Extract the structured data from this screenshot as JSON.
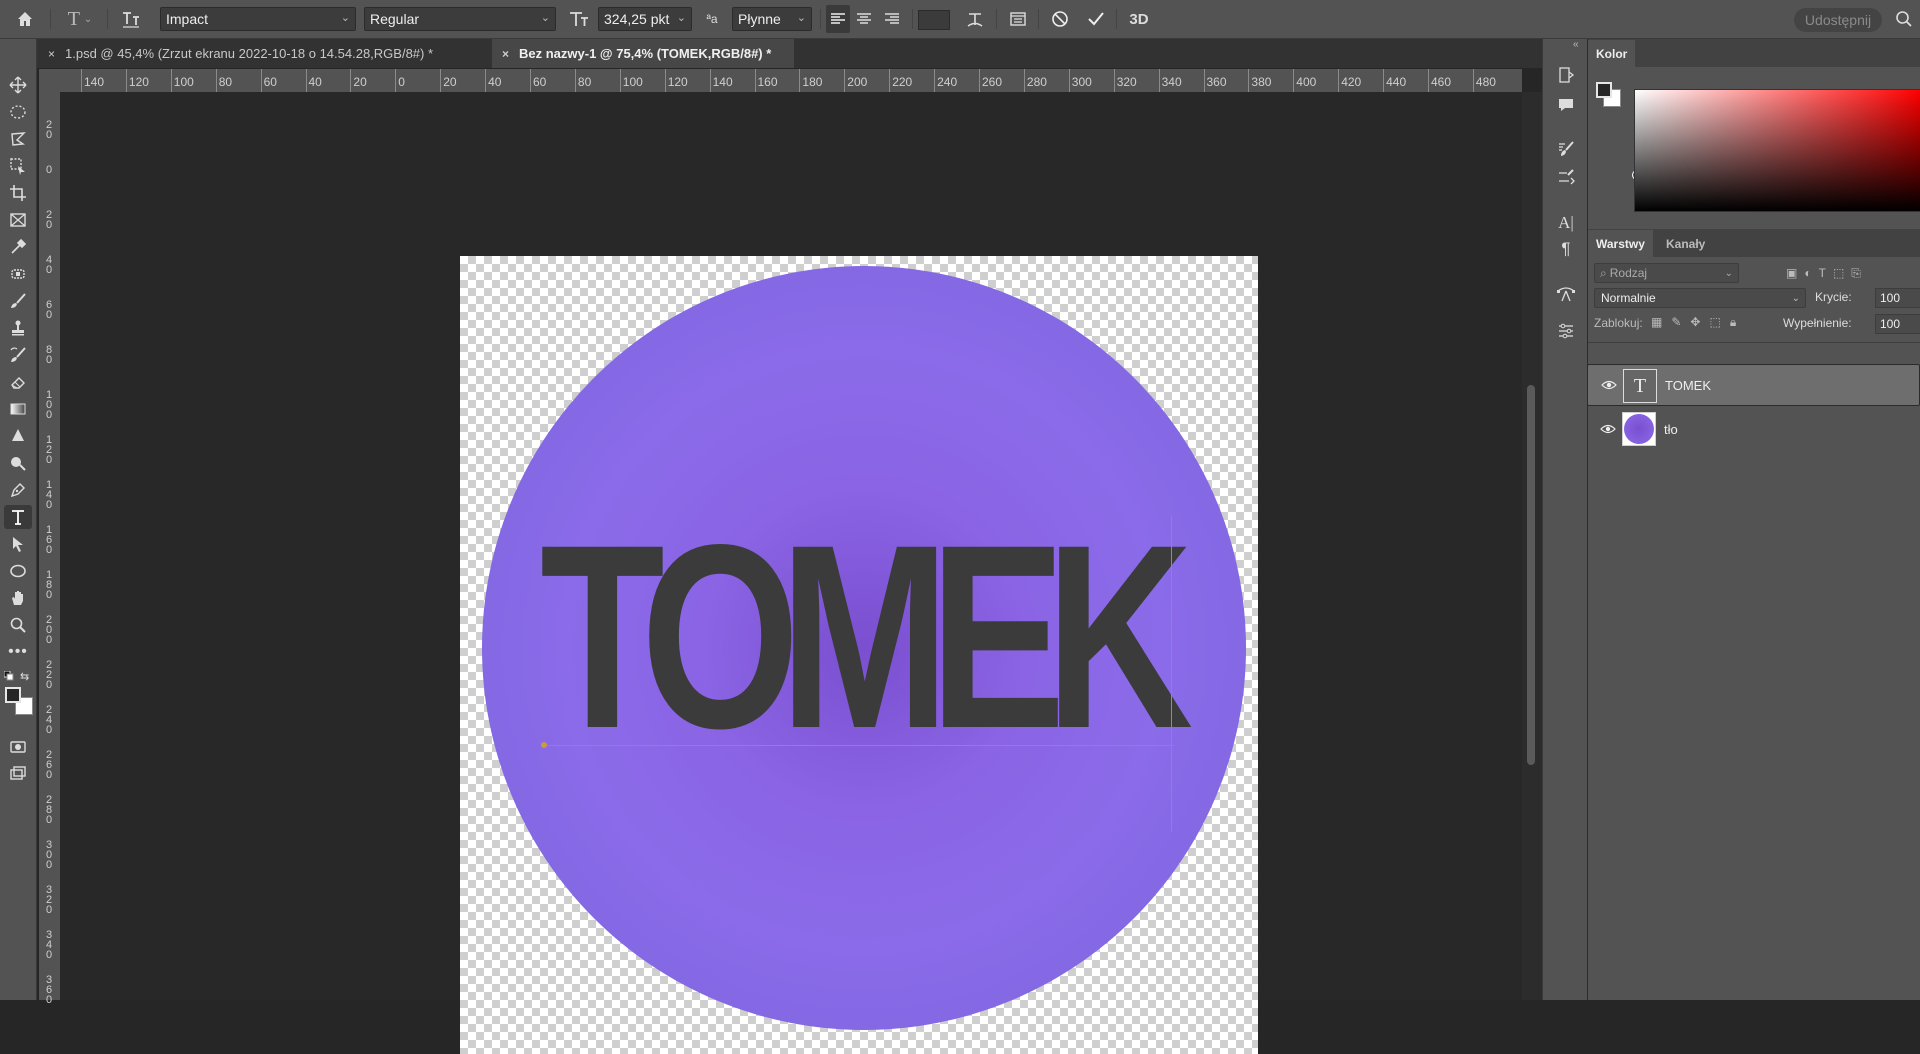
{
  "options_bar": {
    "font_family": "Impact",
    "font_style": "Regular",
    "font_size": "324,25 pkt",
    "anti_alias": "Płynne",
    "share_label": "Udostępnij",
    "threed_label": "3D",
    "aa_label": "ªa"
  },
  "tabs": [
    {
      "label": "1.psd @ 45,4% (Zrzut ekranu 2022-10-18 o 14.54.28,RGB/8#) *",
      "close": "×"
    },
    {
      "label": "Bez nazwy-1 @ 75,4% (TOMEK,RGB/8#) *",
      "close": "×"
    }
  ],
  "ruler": {
    "horizontal_ticks": [
      "140",
      "120",
      "100",
      "80",
      "60",
      "40",
      "20",
      "0",
      "20",
      "40",
      "60",
      "80",
      "100",
      "120",
      "140",
      "160",
      "180",
      "200",
      "220",
      "240",
      "260",
      "280",
      "300",
      "320",
      "340",
      "360",
      "380",
      "400",
      "420",
      "440",
      "460",
      "480"
    ],
    "vertical_ticks": [
      "2 0",
      "0",
      "2 0",
      "4 0",
      "6 0",
      "8 0",
      "1 0 0",
      "1 2 0",
      "1 4 0",
      "1 6 0",
      "1 8 0",
      "2 0 0",
      "2 2 0",
      "2 4 0",
      "2 6 0",
      "2 8 0",
      "3 0 0",
      "3 2 0",
      "3 4 0",
      "3 6 0"
    ]
  },
  "canvas": {
    "text": "TOMEK",
    "circle_color": "#8b6be9",
    "text_color": "#3b3b3b"
  },
  "color_panel": {
    "tab_label": "Kolor"
  },
  "layers_panel": {
    "tabs": [
      "Warstwy",
      "Kanały"
    ],
    "search_placeholder": "Rodzaj",
    "blend_mode": "Normalnie",
    "opacity_label": "Krycie:",
    "opacity_value": "100",
    "lock_label": "Zablokuj:",
    "fill_label": "Wypełnienie:",
    "fill_value": "100",
    "layers": [
      {
        "name": "TOMEK",
        "type": "text",
        "thumb_glyph": "T"
      },
      {
        "name": "tło",
        "type": "image"
      }
    ]
  },
  "colors": {
    "app_bg": "#262626",
    "panel_bg": "#535353",
    "accent_circle": "#8b6be9",
    "guide_line": "#b38a3a"
  }
}
